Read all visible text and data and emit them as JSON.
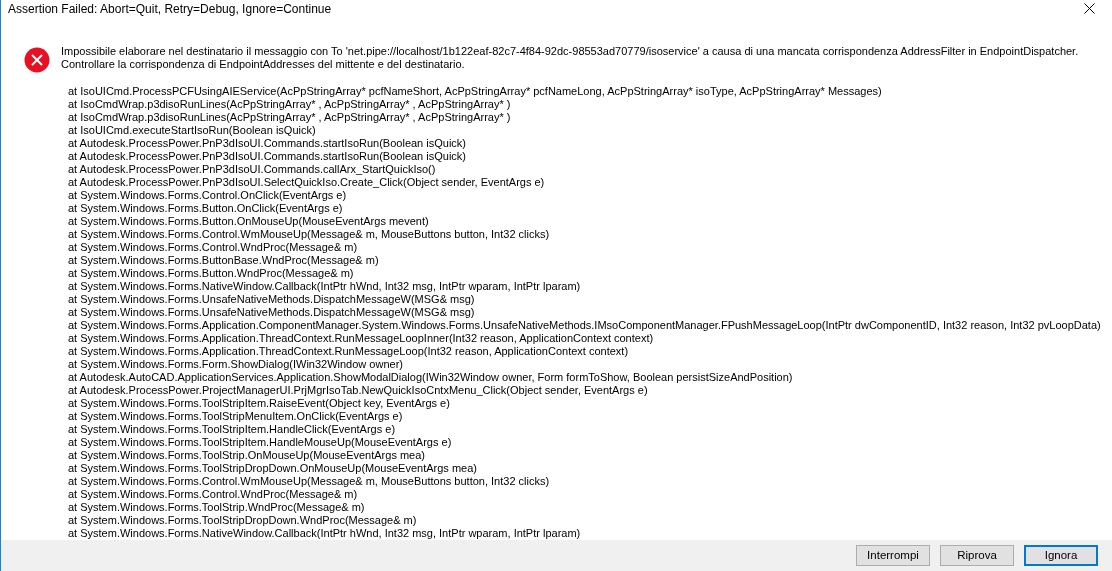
{
  "window": {
    "title": "Assertion Failed: Abort=Quit, Retry=Debug, Ignore=Continue"
  },
  "message": [
    "Impossibile elaborare nel destinatario il messaggio con To 'net.pipe://localhost/1b122eaf-82c7-4f84-92dc-98553ad70779/isoservice' a causa di una mancata corrispondenza AddressFilter in EndpointDispatcher.",
    "Controllare la corrispondenza di EndpointAddresses del mittente e del destinatario."
  ],
  "stack_trace": [
    "at IsoUICmd.ProcessPCFUsingAIEService(AcPpStringArray* pcfNameShort, AcPpStringArray* pcfNameLong, AcPpStringArray* isoType, AcPpStringArray* Messages)",
    "at IsoCmdWrap.p3disoRunLines(AcPpStringArray* , AcPpStringArray* , AcPpStringArray* )",
    "at IsoCmdWrap.p3disoRunLines(AcPpStringArray* , AcPpStringArray* , AcPpStringArray* )",
    "at IsoUICmd.executeStartIsoRun(Boolean isQuick)",
    "at Autodesk.ProcessPower.PnP3dIsoUI.Commands.startIsoRun(Boolean isQuick)",
    "at Autodesk.ProcessPower.PnP3dIsoUI.Commands.startIsoRun(Boolean isQuick)",
    "at Autodesk.ProcessPower.PnP3dIsoUI.Commands.callArx_StartQuickIso()",
    "at Autodesk.ProcessPower.PnP3dIsoUI.SelectQuickIso.Create_Click(Object sender, EventArgs e)",
    "at System.Windows.Forms.Control.OnClick(EventArgs e)",
    "at System.Windows.Forms.Button.OnClick(EventArgs e)",
    "at System.Windows.Forms.Button.OnMouseUp(MouseEventArgs mevent)",
    "at System.Windows.Forms.Control.WmMouseUp(Message& m, MouseButtons button, Int32 clicks)",
    "at System.Windows.Forms.Control.WndProc(Message& m)",
    "at System.Windows.Forms.ButtonBase.WndProc(Message& m)",
    "at System.Windows.Forms.Button.WndProc(Message& m)",
    "at System.Windows.Forms.NativeWindow.Callback(IntPtr hWnd, Int32 msg, IntPtr wparam, IntPtr lparam)",
    "at System.Windows.Forms.UnsafeNativeMethods.DispatchMessageW(MSG& msg)",
    "at System.Windows.Forms.UnsafeNativeMethods.DispatchMessageW(MSG& msg)",
    "at System.Windows.Forms.Application.ComponentManager.System.Windows.Forms.UnsafeNativeMethods.IMsoComponentManager.FPushMessageLoop(IntPtr dwComponentID, Int32 reason, Int32 pvLoopData)",
    "at System.Windows.Forms.Application.ThreadContext.RunMessageLoopInner(Int32 reason, ApplicationContext context)",
    "at System.Windows.Forms.Application.ThreadContext.RunMessageLoop(Int32 reason, ApplicationContext context)",
    "at System.Windows.Forms.Form.ShowDialog(IWin32Window owner)",
    "at Autodesk.AutoCAD.ApplicationServices.Application.ShowModalDialog(IWin32Window owner, Form formToShow, Boolean persistSizeAndPosition)",
    "at Autodesk.ProcessPower.ProjectManagerUI.PrjMgrIsoTab.NewQuickIsoCntxMenu_Click(Object sender, EventArgs e)",
    "at System.Windows.Forms.ToolStripItem.RaiseEvent(Object key, EventArgs e)",
    "at System.Windows.Forms.ToolStripMenuItem.OnClick(EventArgs e)",
    "at System.Windows.Forms.ToolStripItem.HandleClick(EventArgs e)",
    "at System.Windows.Forms.ToolStripItem.HandleMouseUp(MouseEventArgs e)",
    "at System.Windows.Forms.ToolStrip.OnMouseUp(MouseEventArgs mea)",
    "at System.Windows.Forms.ToolStripDropDown.OnMouseUp(MouseEventArgs mea)",
    "at System.Windows.Forms.Control.WmMouseUp(Message& m, MouseButtons button, Int32 clicks)",
    "at System.Windows.Forms.Control.WndProc(Message& m)",
    "at System.Windows.Forms.ToolStrip.WndProc(Message& m)",
    "at System.Windows.Forms.ToolStripDropDown.WndProc(Message& m)",
    "at System.Windows.Forms.NativeWindow.Callback(IntPtr hWnd, Int32 msg, IntPtr wparam, IntPtr lparam)"
  ],
  "buttons": [
    {
      "label": "Interrompi",
      "default": false
    },
    {
      "label": "Riprova",
      "default": false
    },
    {
      "label": "Ignora",
      "default": true
    }
  ]
}
